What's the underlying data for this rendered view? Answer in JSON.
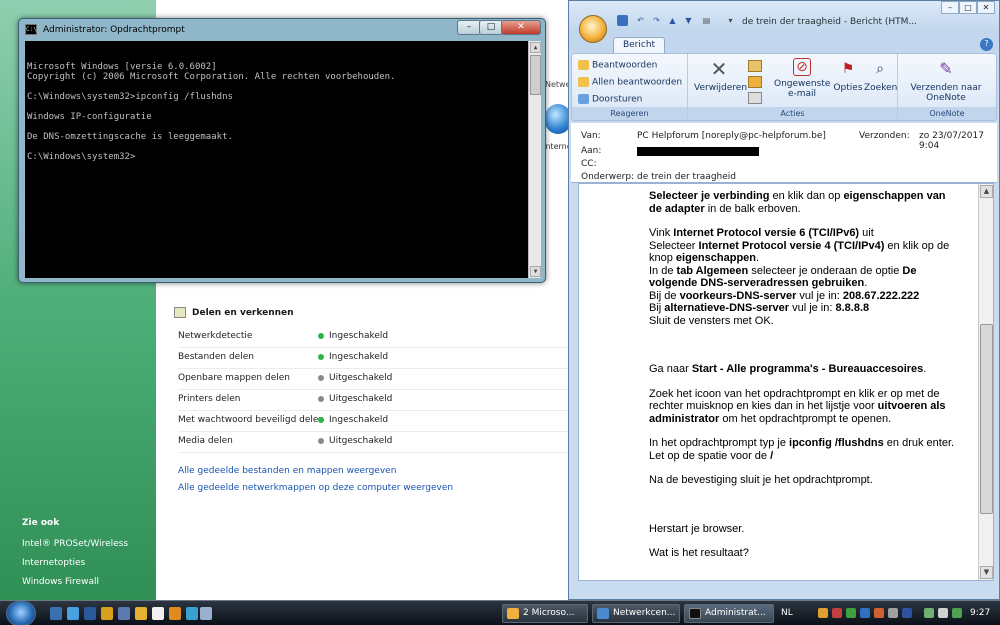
{
  "cmd": {
    "title": "Administrator: Opdrachtprompt",
    "icon_text": "C:\\",
    "lines": [
      "Microsoft Windows [versie 6.0.6002]",
      "Copyright (c) 2006 Microsoft Corporation. Alle rechten voorbehouden.",
      "",
      "C:\\Windows\\system32>ipconfig /flushdns",
      "",
      "Windows IP-configuratie",
      "",
      "De DNS-omzettingscache is leeggemaakt.",
      "",
      "C:\\Windows\\system32>"
    ]
  },
  "network": {
    "peek1": "Netwerk",
    "peek2": "Interne",
    "share_title": "Delen en verkennen",
    "rows": [
      {
        "label": "Netwerkdetectie",
        "status": "Ingeschakeld",
        "on": true
      },
      {
        "label": "Bestanden delen",
        "status": "Ingeschakeld",
        "on": true
      },
      {
        "label": "Openbare mappen delen",
        "status": "Uitgeschakeld",
        "on": false
      },
      {
        "label": "Printers delen",
        "status": "Uitgeschakeld",
        "on": false
      },
      {
        "label": "Met wachtwoord beveiligd delen",
        "status": "Ingeschakeld",
        "on": true
      },
      {
        "label": "Media delen",
        "status": "Uitgeschakeld",
        "on": false
      }
    ],
    "links": [
      "Alle gedeelde bestanden en mappen weergeven",
      "Alle gedeelde netwerkmappen op deze computer weergeven"
    ],
    "see_also": "Zie ook",
    "side_links": [
      "Intel® PROSet/Wireless",
      "Internetopties",
      "Windows Firewall"
    ]
  },
  "outlook": {
    "title": "de trein der traagheid - Bericht (HTM...",
    "tab": "Bericht",
    "reply": {
      "items": [
        "Beantwoorden",
        "Allen beantwoorden",
        "Doorsturen"
      ],
      "group": "Reageren"
    },
    "actions": {
      "delete": "Verwijderen",
      "junk": "Ongewenste e-mail",
      "options": "Opties",
      "find": "Zoeken",
      "group": "Acties"
    },
    "onenote": {
      "send": "Verzenden naar OneNote",
      "group": "OneNote"
    },
    "header": {
      "from_label": "Van:",
      "from": "PC Helpforum [noreply@pc-helpforum.be]",
      "to_label": "Aan:",
      "cc_label": "CC:",
      "subject_label": "Onderwerp:",
      "subject": "de trein der traagheid",
      "sent_label": "Verzonden:",
      "sent": "zo 23/07/2017 9:04"
    },
    "body": {
      "p1a": "Selecteer je verbinding",
      "p1b": " en klik dan op ",
      "p1c": "eigenschappen van de adapter",
      "p1d": " in de balk erboven.",
      "p2a": "Vink ",
      "p2b": "Internet Protocol versie 6 (TCI/IPv6)",
      "p2c": " uit",
      "p3a": "Selecteer ",
      "p3b": "Internet Protocol versie 4 (TCI/IPv4)",
      "p3c": " en klik op de knop ",
      "p3d": "eigenschappen",
      "p3e": ".",
      "p4a": "In de ",
      "p4b": "tab Algemeen",
      "p4c": " selecteer je onderaan de optie ",
      "p4d": "De volgende DNS-serveradressen gebruiken",
      "p4e": ".",
      "p5a": "Bij de ",
      "p5b": "voorkeurs-DNS-server",
      "p5c": " vul je in: ",
      "p5d": "208.67.222.222",
      "p6a": "Bij ",
      "p6b": "alternatieve-DNS-server",
      "p6c": " vul je in: ",
      "p6d": "8.8.8.8",
      "p7": "Sluit de vensters met OK.",
      "p8a": "Ga naar ",
      "p8b": "Start - Alle programma's - Bureauaccesoires",
      "p8c": ".",
      "p9a": "Zoek het icoon van het opdrachtprompt en klik er op met de rechter muisknop en kies dan in het lijstje voor ",
      "p9b": "uitvoeren als administrator",
      "p9c": " om het opdrachtprompt te openen.",
      "p10a": "In het opdrachtprompt typ je ",
      "p10b": "ipconfig /flushdns",
      "p10c": " en druk enter. Let op de spatie voor de ",
      "p10d": "/",
      "p11": "Na de bevestiging sluit je het opdrachtprompt.",
      "p12": "Herstart je browser.",
      "p13": "Wat is het resultaat?"
    }
  },
  "taskbar": {
    "tasks": [
      "2 Microso...",
      "Netwerkcen...",
      "Administrat..."
    ],
    "lang": "NL",
    "clock": "9:27"
  },
  "colors": {
    "accent": "#1a55b0",
    "on": "#2fb34a",
    "off": "#8a8a8a"
  }
}
